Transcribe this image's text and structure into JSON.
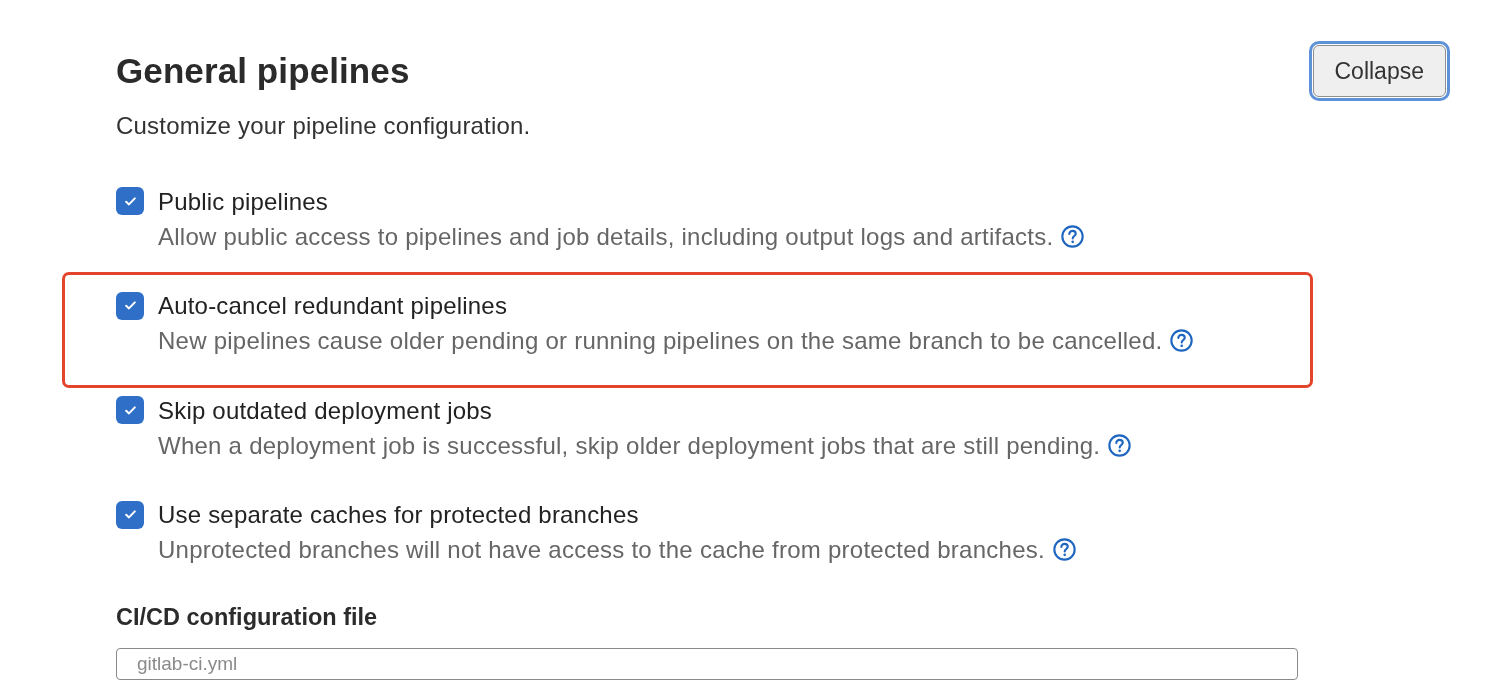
{
  "section": {
    "title": "General pipelines",
    "description": "Customize your pipeline configuration.",
    "collapse_button": {
      "label": "Collapse",
      "focused": true
    }
  },
  "options": [
    {
      "label": "Public pipelines",
      "description": "Allow public access to pipelines and job details, including output logs and artifacts.",
      "checked": true,
      "highlighted": false
    },
    {
      "label": "Auto-cancel redundant pipelines",
      "description": "New pipelines cause older pending or running pipelines on the same branch to be cancelled.",
      "checked": true,
      "highlighted": true
    },
    {
      "label": "Skip outdated deployment jobs",
      "description": "When a deployment job is successful, skip older deployment jobs that are still pending.",
      "checked": true,
      "highlighted": false
    },
    {
      "label": "Use separate caches for protected branches",
      "description": "Unprotected branches will not have access to the cache from protected branches.",
      "checked": true,
      "highlighted": false
    }
  ],
  "config_file": {
    "label": "CI/CD configuration file",
    "field": {
      "placeholder": "gitlab-ci.yml"
    }
  }
}
